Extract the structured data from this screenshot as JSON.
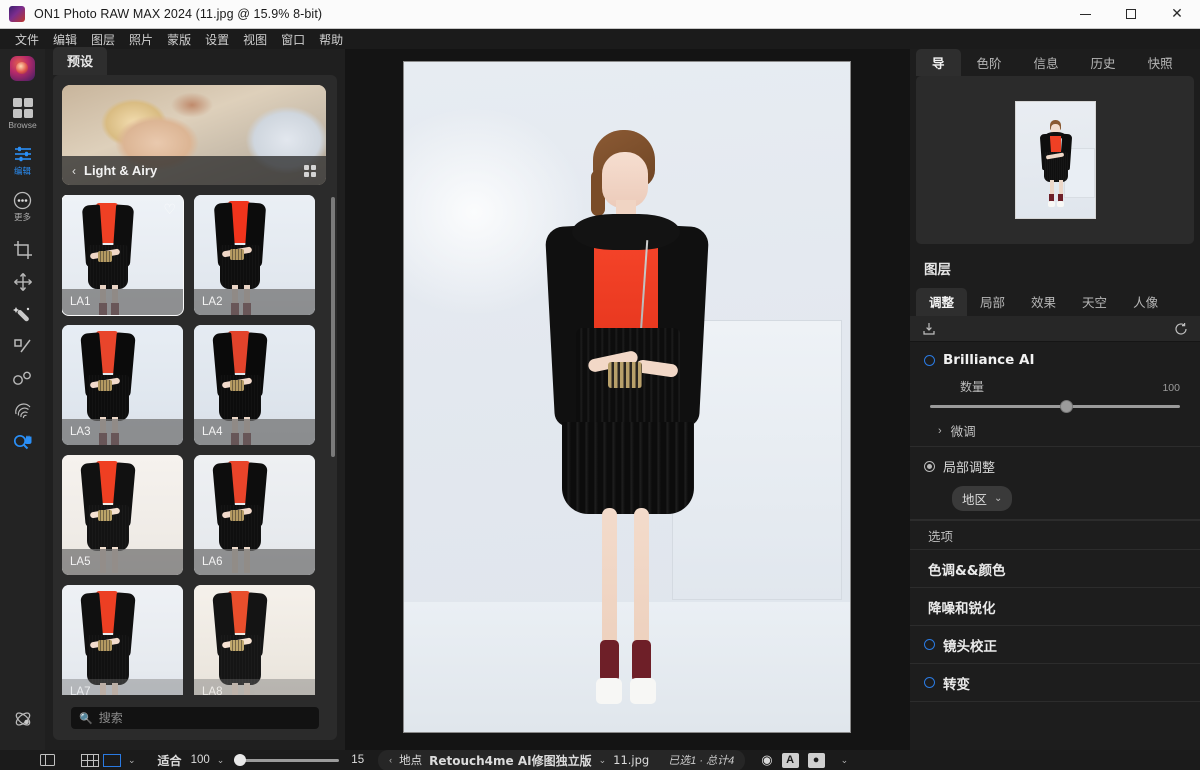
{
  "window": {
    "title": "ON1 Photo RAW MAX 2024 (11.jpg @ 15.9% 8-bit)",
    "minimize": "–",
    "maximize": "□",
    "close": "✕"
  },
  "menubar": {
    "items": [
      "文件",
      "编辑",
      "图层",
      "照片",
      "蒙版",
      "设置",
      "视图",
      "窗口",
      "帮助"
    ]
  },
  "left_toolbar": {
    "modules": [
      {
        "label": "Browse",
        "icon": "grid-icon",
        "active": false
      },
      {
        "label": "编辑",
        "icon": "sliders-icon",
        "active": true
      },
      {
        "label": "更多",
        "icon": "more-dots-icon",
        "active": false
      }
    ],
    "tools": [
      {
        "name": "crop-tool",
        "icon": "crop-icon",
        "active": false
      },
      {
        "name": "transform-tool",
        "icon": "move-arrows-icon",
        "active": false
      },
      {
        "name": "retouch-brush-tool",
        "icon": "magic-wand-icon",
        "active": false
      },
      {
        "name": "perfect-brush-tool",
        "icon": "brush-icon",
        "active": false
      },
      {
        "name": "blemish-remover-tool",
        "icon": "two-circles-icon",
        "active": false
      },
      {
        "name": "clone-stamp-tool",
        "icon": "fingerprint-icon",
        "active": false
      },
      {
        "name": "zoom-tool",
        "icon": "magnifier-hand-icon",
        "active": true
      }
    ],
    "bottom_tool": {
      "name": "orbit-tool",
      "icon": "orbit-icon"
    }
  },
  "presets": {
    "tab_label": "预设",
    "category": {
      "name": "Light & Airy",
      "back_chevron": "‹",
      "grid_icon": "grid-view-icon"
    },
    "items": [
      {
        "label": "LA1",
        "selected": true,
        "favorite": true,
        "tone": "bright"
      },
      {
        "label": "LA2",
        "selected": false,
        "favorite": false,
        "tone": "bright"
      },
      {
        "label": "LA3",
        "selected": false,
        "favorite": false,
        "tone": "cool"
      },
      {
        "label": "LA4",
        "selected": false,
        "favorite": false,
        "tone": "cool"
      },
      {
        "label": "LA5",
        "selected": false,
        "favorite": false,
        "tone": "warm"
      },
      {
        "label": "LA6",
        "selected": false,
        "favorite": false,
        "tone": "warm"
      },
      {
        "label": "LA7",
        "selected": false,
        "favorite": false,
        "tone": "neutral"
      },
      {
        "label": "LA8",
        "selected": false,
        "favorite": false,
        "tone": "sepia"
      }
    ],
    "search": {
      "placeholder": "搜索",
      "value": "",
      "icon": "search-icon"
    }
  },
  "right_panel": {
    "top_tabs": [
      {
        "label": "导",
        "active": true
      },
      {
        "label": "色阶",
        "active": false
      },
      {
        "label": "信息",
        "active": false
      },
      {
        "label": "历史",
        "active": false
      },
      {
        "label": "快照",
        "active": false
      }
    ],
    "layers_title": "图层",
    "sub_tabs": [
      {
        "label": "调整",
        "active": true
      },
      {
        "label": "局部",
        "active": false
      },
      {
        "label": "效果",
        "active": false
      },
      {
        "label": "天空",
        "active": false
      },
      {
        "label": "人像",
        "active": false
      }
    ],
    "toolstrip": {
      "left_icon": "export-preset-icon",
      "right_icon": "reset-icon"
    },
    "adjustment": {
      "title": "Brilliance AI",
      "enabled": true,
      "slider": {
        "label": "数量",
        "value": "100",
        "percent": 57
      },
      "fine_tune": {
        "label": "微调",
        "chevron": "›"
      },
      "local_adjust": {
        "label": "局部调整"
      },
      "region_pill": {
        "label": "地区",
        "chevron": "⌄"
      },
      "options_label": "选项"
    },
    "sections": [
      {
        "label": "色调&&颜色",
        "has_toggle": false
      },
      {
        "label": "降噪和锐化",
        "has_toggle": false
      },
      {
        "label": "镜头校正",
        "has_toggle": true
      },
      {
        "label": "转变",
        "has_toggle": true
      }
    ]
  },
  "bottom_bar": {
    "panel_toggle_icon": "show-panels-icon",
    "grid_icon": "grid-view-icon",
    "compare_icon": "compare-view-icon",
    "view_chevron": "⌄",
    "fit_label": "适合",
    "fit_value": "100",
    "fit_chevron": "⌄",
    "zoom_value": "15",
    "zoom_percent": 0,
    "location": {
      "back_chevron": "‹",
      "label": "地点",
      "folder": "Retouch4me AI修图独立版",
      "chevron": "⌄",
      "filename": "11.jpg"
    },
    "selection_status": "已选1 · 总计4",
    "icons": [
      {
        "name": "preview-eye-icon",
        "glyph": "◉"
      },
      {
        "name": "letter-a-icon",
        "glyph": "A"
      },
      {
        "name": "soft-proof-icon",
        "glyph": "●"
      }
    ],
    "trailing_chevron": "⌄"
  },
  "colors": {
    "accent_blue": "#2a7ae2",
    "panel_bg": "#1d1d1d",
    "canvas_bg": "#141414",
    "titlebar_bg": "#fbfbfb"
  }
}
